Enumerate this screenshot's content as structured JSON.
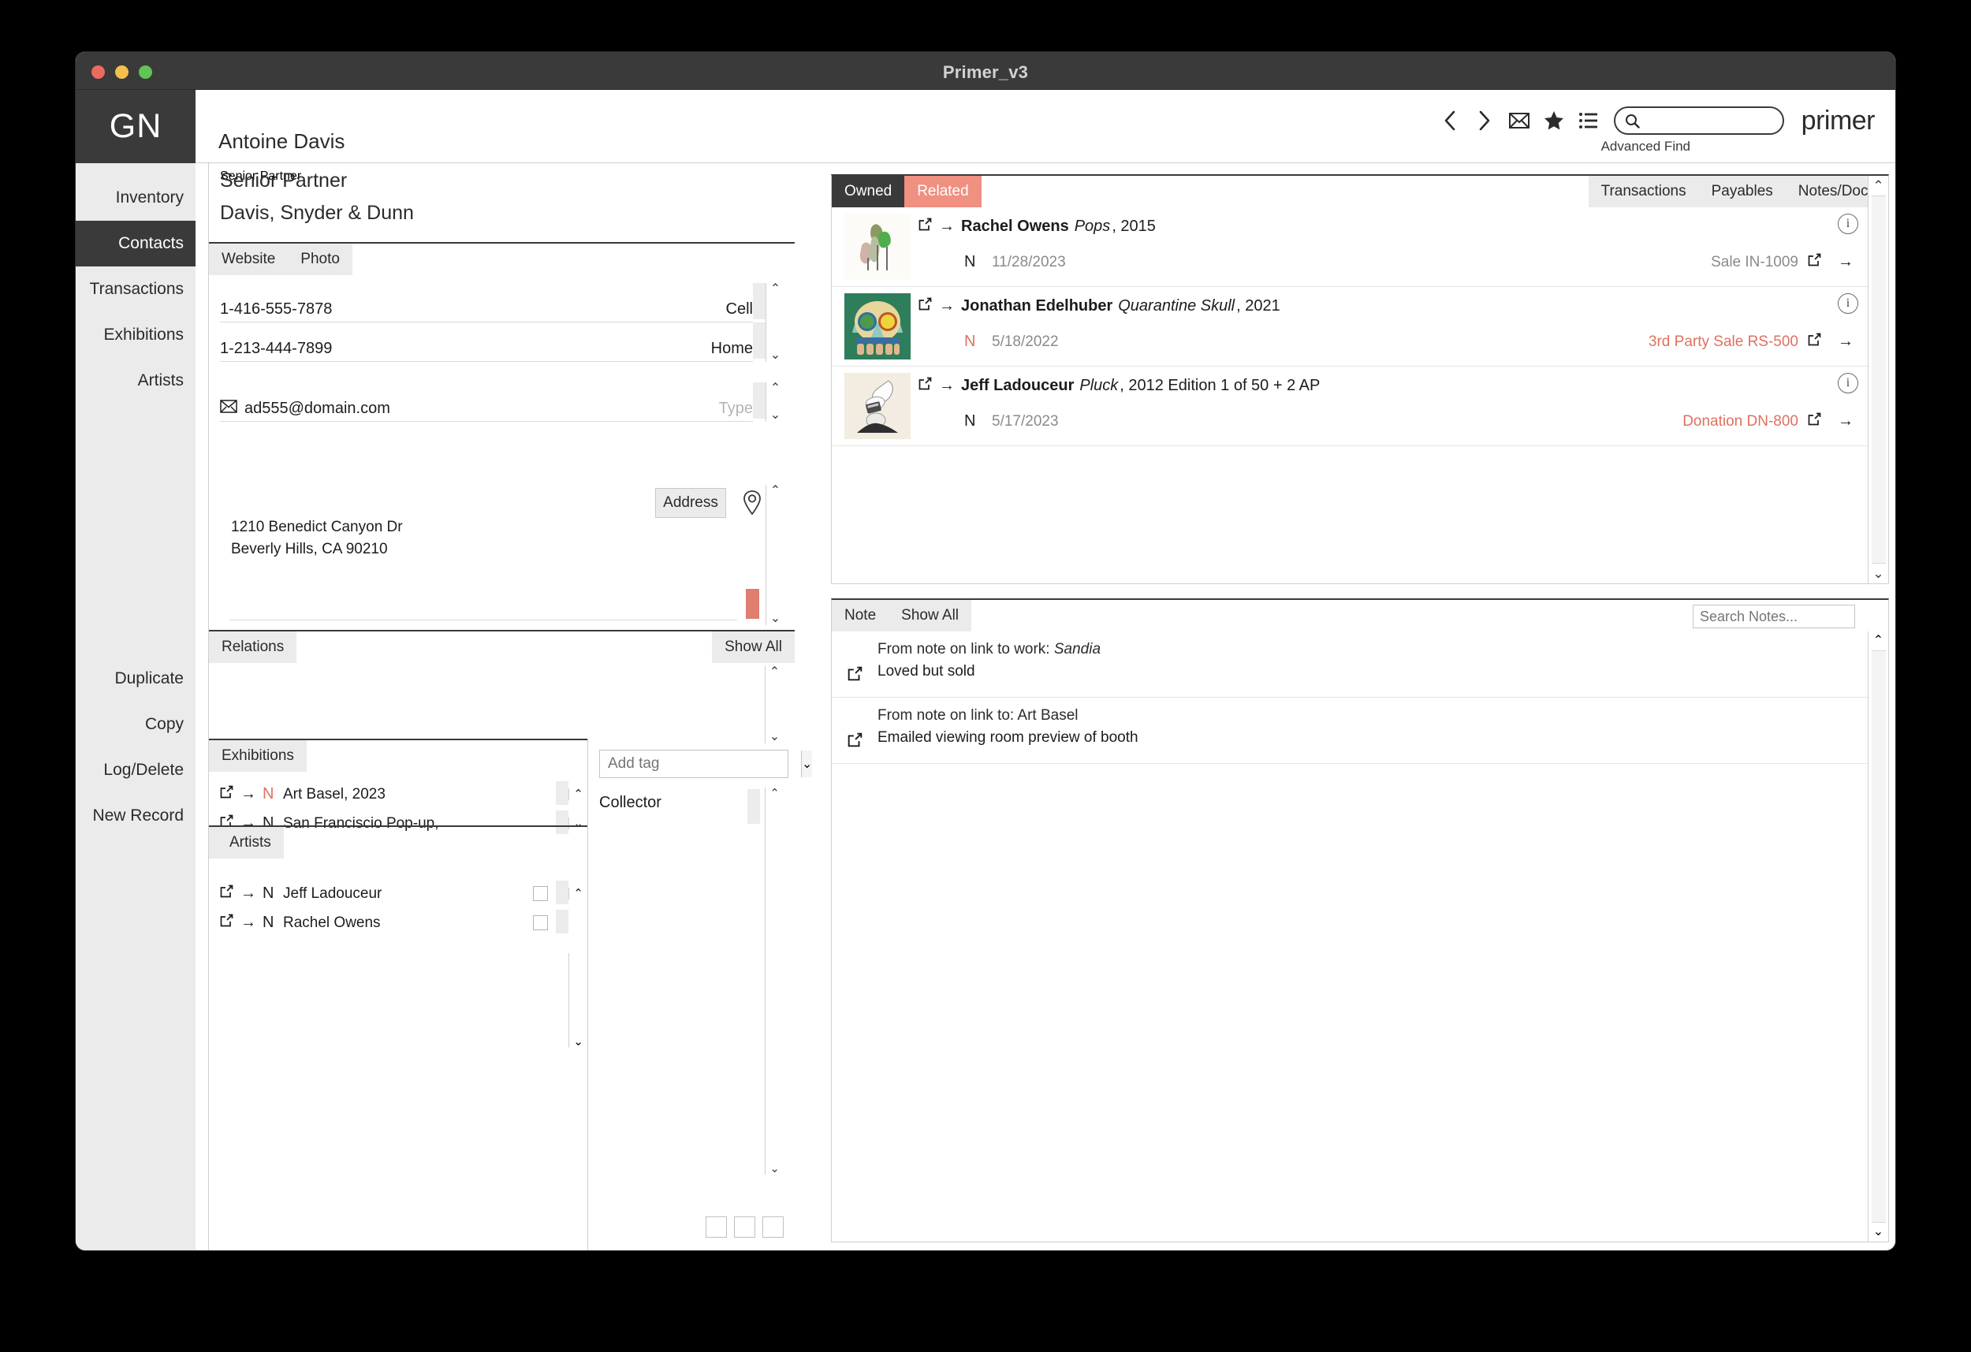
{
  "window": {
    "title": "Primer_v3",
    "traffic_lights": [
      "close",
      "minimize",
      "zoom"
    ]
  },
  "rail": {
    "logo": "GN",
    "top_items": [
      {
        "label": "Inventory",
        "active": false
      },
      {
        "label": "Contacts",
        "active": true
      },
      {
        "label": "Transactions",
        "active": false
      },
      {
        "label": "Exhibitions",
        "active": false
      },
      {
        "label": "Artists",
        "active": false
      }
    ],
    "bottom_items": [
      {
        "label": "Duplicate"
      },
      {
        "label": "Copy"
      },
      {
        "label": "Log/Delete"
      },
      {
        "label": "New Record"
      }
    ]
  },
  "topbar": {
    "record_name": "Antoine Davis",
    "brand": "primer",
    "advanced_find": "Advanced Find",
    "search_value": "",
    "search_placeholder": "",
    "icons": [
      "back-icon",
      "forward-icon",
      "mail-icon",
      "star-icon",
      "list-icon",
      "search-icon"
    ]
  },
  "contact": {
    "role": "Senior Partner",
    "company": "Davis, Snyder & Dunn",
    "tabs": [
      "Website",
      "Photo"
    ],
    "phones": [
      {
        "number": "1-416-555-7878",
        "type": "Cell"
      },
      {
        "number": "1-213-444-7899",
        "type": "Home"
      }
    ],
    "email": {
      "value": "ad555@domain.com",
      "type_placeholder": "Type"
    },
    "address": {
      "button": "Address",
      "line1": "1210  Benedict Canyon Dr",
      "line2": "Beverly Hills, CA 90210"
    }
  },
  "relations": {
    "title": "Relations",
    "show_all": "Show All",
    "items": []
  },
  "exhibitions": {
    "title": "Exhibitions",
    "items": [
      {
        "flag": "N",
        "flag_red": true,
        "label": "Art Basel, 2023"
      },
      {
        "flag": "N",
        "flag_red": false,
        "label": "San Franciscio Pop-up,"
      }
    ]
  },
  "artists": {
    "title": "Artists",
    "items": [
      {
        "flag": "N",
        "label": "Jeff Ladouceur",
        "checked": false
      },
      {
        "flag": "N",
        "label": "Rachel Owens",
        "checked": false
      }
    ]
  },
  "tags": {
    "input_value": "",
    "input_placeholder": "Add tag",
    "items": [
      "Collector"
    ]
  },
  "works": {
    "left_tabs": [
      {
        "label": "Owned",
        "state": "dark"
      },
      {
        "label": "Related",
        "state": "salmon"
      }
    ],
    "right_tabs": [
      "Transactions",
      "Payables",
      "Notes/Docs"
    ],
    "rows": [
      {
        "thumb": "pops-sculpture-thumbnail",
        "artist": "Rachel Owens",
        "title": "Pops",
        "year": ", 2015",
        "flag": "N",
        "flag_red": false,
        "date": "11/28/2023",
        "trailing_label": "Sale IN-1009",
        "trailing_red": false
      },
      {
        "thumb": "quarantine-skull-painting-thumbnail",
        "artist": "Jonathan Edelhuber",
        "title": "Quarantine Skull",
        "year": ", 2021",
        "flag": "N",
        "flag_red": true,
        "date": "5/18/2022",
        "trailing_label": "3rd Party Sale RS-500",
        "trailing_red": true
      },
      {
        "thumb": "pluck-drawing-thumbnail",
        "artist": "Jeff Ladouceur",
        "title": "Pluck",
        "year": ", 2012 Edition 1 of 50 + 2 AP",
        "flag": "N",
        "flag_red": false,
        "date": "5/17/2023",
        "trailing_label": "Donation DN-800",
        "trailing_red": true
      }
    ]
  },
  "notes": {
    "tabs": [
      "Note",
      "Show All"
    ],
    "search_value": "",
    "search_placeholder": "Search Notes...",
    "items": [
      {
        "source_prefix": "From note on link to work: ",
        "source_italic": "Sandia",
        "text": "Loved but sold"
      },
      {
        "source_prefix": "From note on link to: Art Basel",
        "source_italic": "",
        "text": "Emailed viewing room preview of booth"
      }
    ]
  },
  "colors": {
    "accent_salmon": "#ef9080",
    "accent_red": "#e0705f",
    "dark": "#3a3a3a",
    "rail_bg": "#ebebeb"
  }
}
